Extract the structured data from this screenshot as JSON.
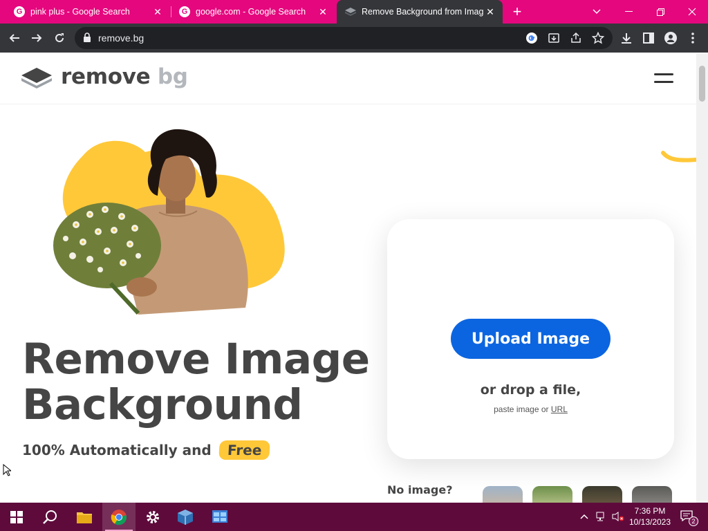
{
  "browser": {
    "tabs": [
      {
        "title": "pink plus - Google Search",
        "active": false
      },
      {
        "title": "google.com - Google Search",
        "active": false
      },
      {
        "title": "Remove Background from Image",
        "active": true
      }
    ],
    "url": "remove.bg"
  },
  "site": {
    "logo": {
      "part1": "remove",
      "part2": "bg"
    },
    "hero": {
      "title_line1": "Remove Image",
      "title_line2": "Background",
      "sub_text": "100% Automatically and",
      "sub_highlight": "Free"
    },
    "upload": {
      "button_label": "Upload Image",
      "drop_text": "or drop a file,",
      "paste_prefix": "paste image or",
      "paste_link": "URL"
    },
    "sample": {
      "label": "No image?"
    }
  },
  "taskbar": {
    "time": "7:36 PM",
    "date": "10/13/2023",
    "notification_count": "2"
  },
  "colors": {
    "tabstrip": "#e5077e",
    "toolbar": "#35363a",
    "accent_blue": "#0c65e0",
    "yellow": "#ffc839",
    "taskbar": "#5e0b3c"
  }
}
